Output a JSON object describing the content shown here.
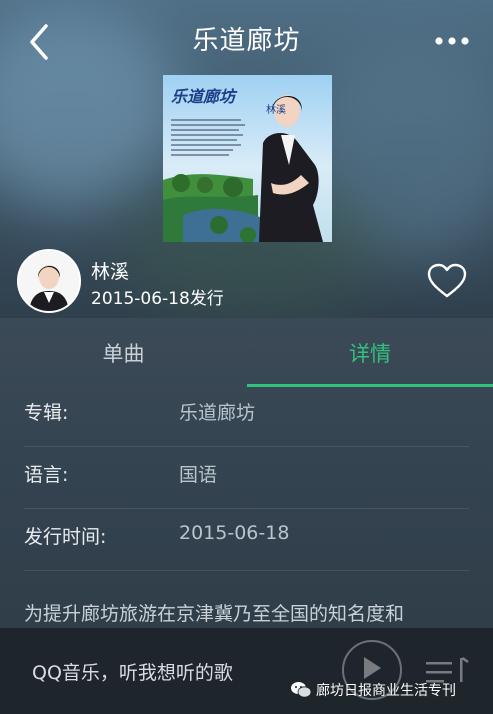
{
  "header": {
    "title": "乐道廊坊",
    "back_icon": "chevron-left-icon",
    "more_icon": "more-horizontal-icon"
  },
  "cover": {
    "title_text": "乐道廊坊",
    "subtitle_text": "林溪"
  },
  "artist": {
    "name": "林溪",
    "release_line": "2015-06-18发行",
    "favorite_icon": "heart-outline-icon"
  },
  "tabs": [
    {
      "label": "单曲",
      "active": false
    },
    {
      "label": "详情",
      "active": true
    }
  ],
  "details": [
    {
      "label": "专辑:",
      "value": "乐道廊坊"
    },
    {
      "label": "语言:",
      "value": "国语"
    },
    {
      "label": "发行时间:",
      "value": "2015-06-18"
    }
  ],
  "description": "为提升廊坊旅游在京津冀乃至全国的知名度和",
  "player": {
    "slogan": "QQ音乐，听我想听的歌",
    "play_icon": "play-icon",
    "playlist_icon": "playlist-icon"
  },
  "watermark": {
    "text": "廊坊日报商业生活专刊",
    "icon": "wechat-icon"
  },
  "colors": {
    "accent": "#31c27c",
    "text_primary": "#ffffff"
  }
}
